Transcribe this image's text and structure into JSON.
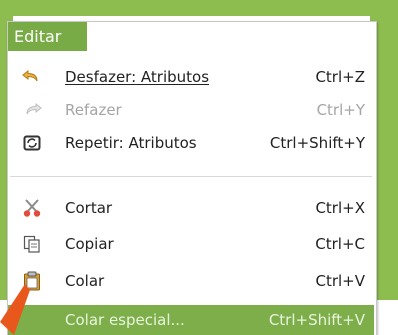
{
  "menu": {
    "title": "Editar",
    "items": [
      {
        "label": "Desfazer: Atributos",
        "shortcut": "Ctrl+Z",
        "icon": "undo-icon",
        "enabled": true
      },
      {
        "label": "Refazer",
        "shortcut": "Ctrl+Y",
        "icon": "redo-icon",
        "enabled": false
      },
      {
        "label": "Repetir: Atributos",
        "shortcut": "Ctrl+Shift+Y",
        "icon": "repeat-icon",
        "enabled": true
      },
      {
        "label": "Cortar",
        "shortcut": "Ctrl+X",
        "icon": "scissors-icon",
        "enabled": true
      },
      {
        "label": "Copiar",
        "shortcut": "Ctrl+C",
        "icon": "copy-icon",
        "enabled": true
      },
      {
        "label": "Colar",
        "shortcut": "Ctrl+V",
        "icon": "paste-icon",
        "enabled": true
      },
      {
        "label": "Colar especial...",
        "shortcut": "Ctrl+Shift+V",
        "icon": "",
        "enabled": true,
        "selected": true
      }
    ]
  },
  "colors": {
    "accent_green": "#8cbd4e",
    "selection_green": "#7dae4a",
    "arrow_orange": "#e8581c"
  }
}
